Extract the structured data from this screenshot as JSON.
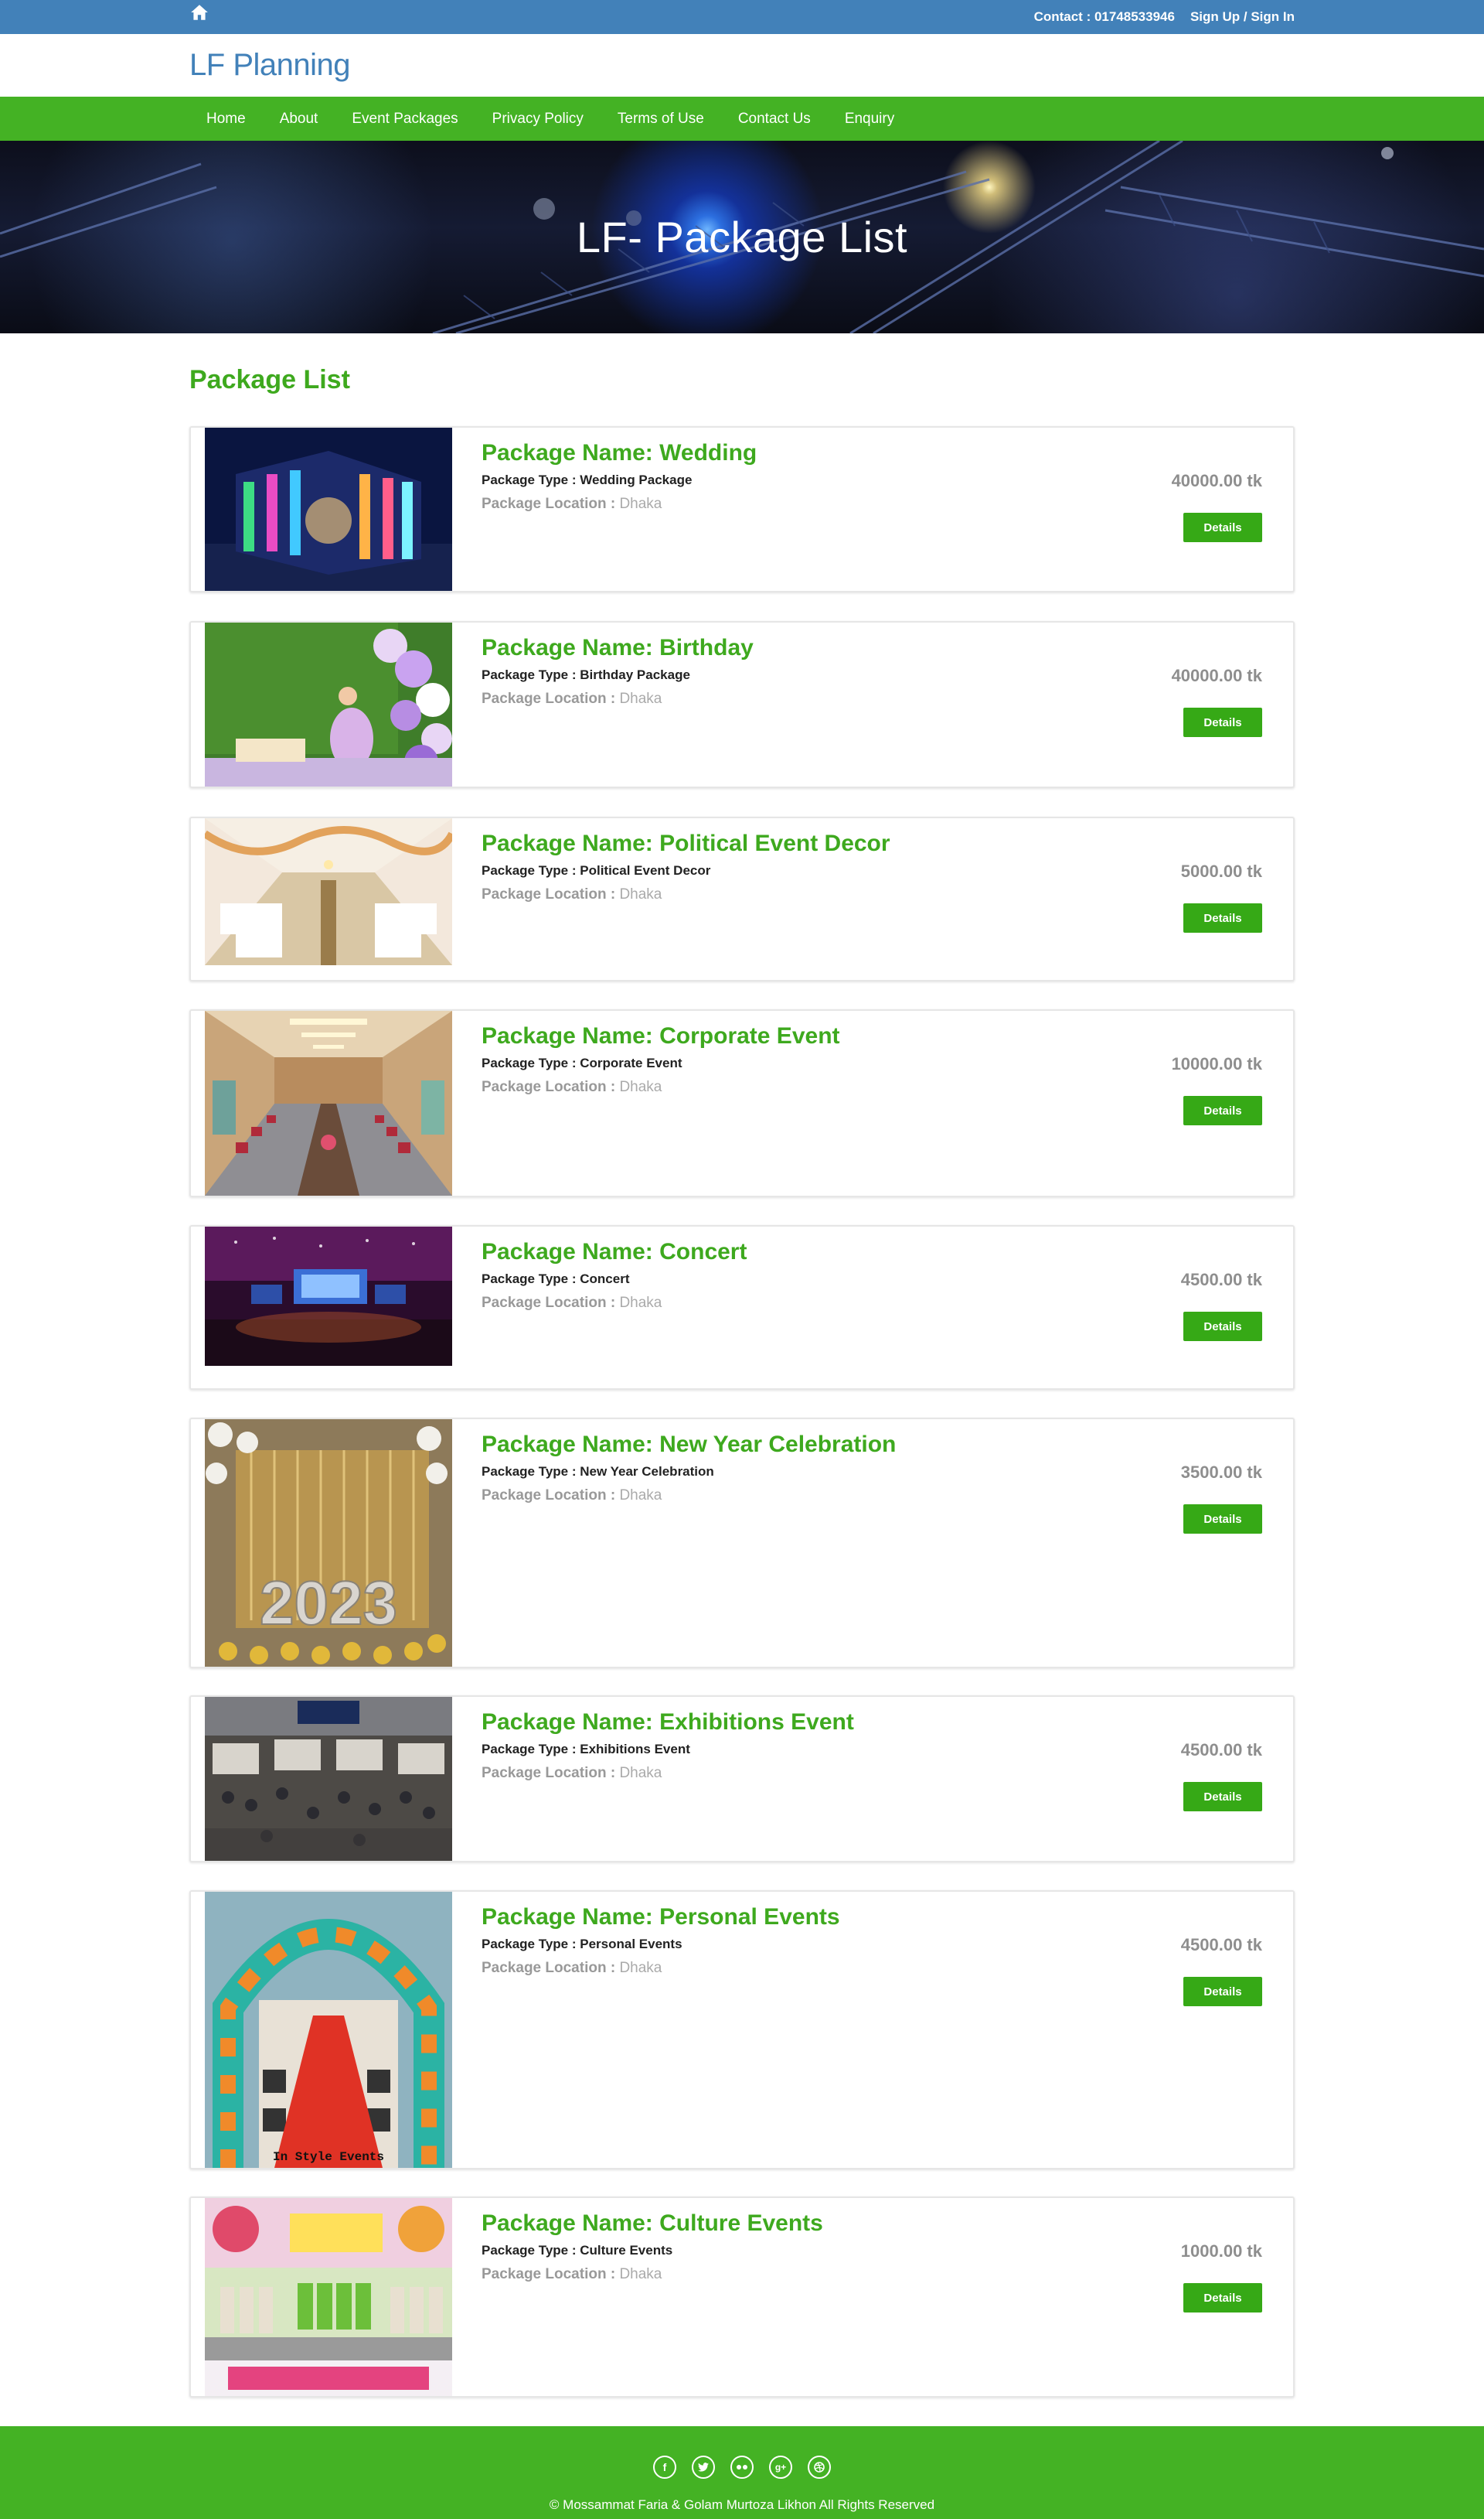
{
  "topbar": {
    "contact": "Contact : 01748533946",
    "signin": "Sign Up / Sign In"
  },
  "brand": {
    "lf": "LF",
    "name": "Planning"
  },
  "nav": {
    "items": [
      "Home",
      "About",
      "Event Packages",
      "Privacy Policy",
      "Terms of Use",
      "Contact Us",
      "Enquiry"
    ]
  },
  "hero": {
    "title": "LF- Package List"
  },
  "main": {
    "heading": "Package List"
  },
  "labels": {
    "type_prefix": "Package Type : ",
    "location_prefix": "Package Location : ",
    "details": "Details"
  },
  "packages": [
    {
      "name": "Package Name: Wedding",
      "type": "Wedding Package",
      "location": "Dhaka",
      "price": "40000.00 tk",
      "image_icon": "wedding-photo"
    },
    {
      "name": "Package Name: Birthday",
      "type": "Birthday Package",
      "location": "Dhaka",
      "price": "40000.00 tk",
      "image_icon": "birthday-photo"
    },
    {
      "name": "Package Name: Political Event Decor",
      "type": "Political Event Decor",
      "location": "Dhaka",
      "price": "5000.00 tk",
      "image_icon": "hall-photo"
    },
    {
      "name": "Package Name: Corporate Event",
      "type": "Corporate Event",
      "location": "Dhaka",
      "price": "10000.00 tk",
      "image_icon": "conference-room-photo"
    },
    {
      "name": "Package Name: Concert",
      "type": "Concert",
      "location": "Dhaka",
      "price": "4500.00 tk",
      "image_icon": "concert-photo"
    },
    {
      "name": "Package Name: New Year Celebration",
      "type": "New Year Celebration",
      "location": "Dhaka",
      "price": "3500.00 tk",
      "image_icon": "new-year-balloons-photo",
      "image_text": "2023"
    },
    {
      "name": "Package Name: Exhibitions Event",
      "type": "Exhibitions Event",
      "location": "Dhaka",
      "price": "4500.00 tk",
      "image_icon": "exhibition-photo"
    },
    {
      "name": "Package Name: Personal Events",
      "type": "Personal Events",
      "location": "Dhaka",
      "price": "4500.00 tk",
      "image_icon": "balloon-arch-photo",
      "image_text": "In Style Events"
    },
    {
      "name": "Package Name: Culture Events",
      "type": "Culture Events",
      "location": "Dhaka",
      "price": "1000.00 tk",
      "image_icon": "culture-stage-photo"
    }
  ],
  "footer": {
    "social": [
      "facebook-icon",
      "twitter-icon",
      "flickr-icon",
      "google-plus-icon",
      "dribbble-icon"
    ],
    "copyright": "© Mossammat Faria & Golam Murtoza Likhon All Rights Reserved"
  },
  "colors": {
    "topbar": "#4281b9",
    "nav": "#44b224",
    "accent_green": "#3ea91e",
    "button": "#36a916"
  }
}
